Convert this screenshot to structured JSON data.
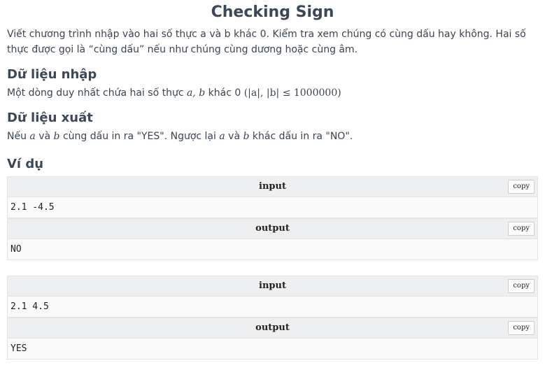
{
  "problem": {
    "title": "Checking Sign",
    "statement": "Viết chương trình nhập vào hai số thực a và b khác 0. Kiểm tra xem chúng có cùng dấu hay không. Hai số thực được gọi là “cùng dấu” nếu như chúng cùng dương hoặc cùng âm.",
    "input_heading": "Dữ liệu nhập",
    "input_text_1": "Một dòng duy nhất chứa hai số thực ",
    "input_text_2": " khác 0 ",
    "input_math_vars": "a, b",
    "input_math_cond": "(|a|, |b| ≤ 1000000)",
    "output_heading": "Dữ liệu xuất",
    "output_text_1": "Nếu ",
    "output_text_2": " và ",
    "output_text_3": " cùng dấu in ra \"YES\". Ngược lại ",
    "output_text_4": " và ",
    "output_text_5": " khác dấu in ra \"NO\".",
    "var_a": "a",
    "var_b": "b",
    "examples_heading": "Ví dụ"
  },
  "examples": [
    {
      "input_label": "input",
      "input_value": "2.1 -4.5",
      "output_label": "output",
      "output_value": "NO",
      "copy_label": "copy"
    },
    {
      "input_label": "input",
      "input_value": "2.1 4.5",
      "output_label": "output",
      "output_value": "YES",
      "copy_label": "copy"
    }
  ]
}
